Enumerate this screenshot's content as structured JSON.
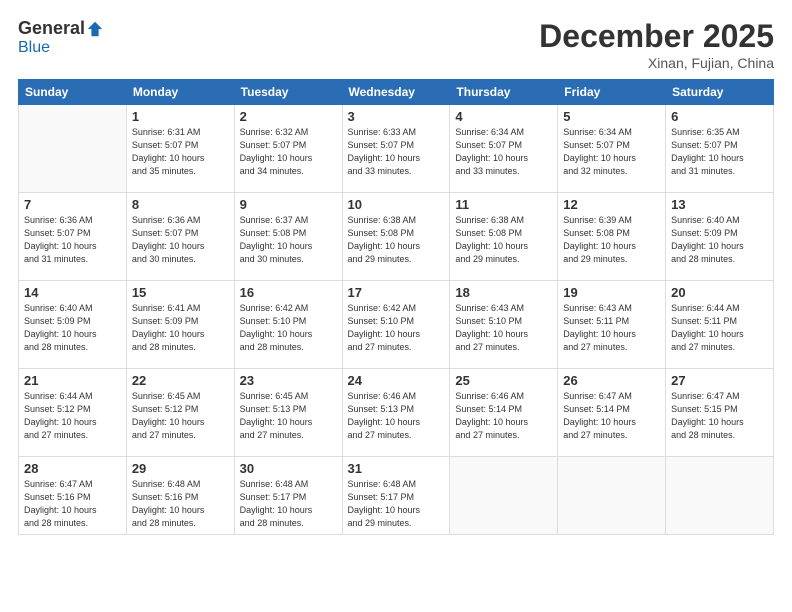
{
  "logo": {
    "general": "General",
    "blue": "Blue"
  },
  "header": {
    "month": "December 2025",
    "location": "Xinan, Fujian, China"
  },
  "weekdays": [
    "Sunday",
    "Monday",
    "Tuesday",
    "Wednesday",
    "Thursday",
    "Friday",
    "Saturday"
  ],
  "weeks": [
    [
      {
        "day": "",
        "info": ""
      },
      {
        "day": "1",
        "info": "Sunrise: 6:31 AM\nSunset: 5:07 PM\nDaylight: 10 hours\nand 35 minutes."
      },
      {
        "day": "2",
        "info": "Sunrise: 6:32 AM\nSunset: 5:07 PM\nDaylight: 10 hours\nand 34 minutes."
      },
      {
        "day": "3",
        "info": "Sunrise: 6:33 AM\nSunset: 5:07 PM\nDaylight: 10 hours\nand 33 minutes."
      },
      {
        "day": "4",
        "info": "Sunrise: 6:34 AM\nSunset: 5:07 PM\nDaylight: 10 hours\nand 33 minutes."
      },
      {
        "day": "5",
        "info": "Sunrise: 6:34 AM\nSunset: 5:07 PM\nDaylight: 10 hours\nand 32 minutes."
      },
      {
        "day": "6",
        "info": "Sunrise: 6:35 AM\nSunset: 5:07 PM\nDaylight: 10 hours\nand 31 minutes."
      }
    ],
    [
      {
        "day": "7",
        "info": "Sunrise: 6:36 AM\nSunset: 5:07 PM\nDaylight: 10 hours\nand 31 minutes."
      },
      {
        "day": "8",
        "info": "Sunrise: 6:36 AM\nSunset: 5:07 PM\nDaylight: 10 hours\nand 30 minutes."
      },
      {
        "day": "9",
        "info": "Sunrise: 6:37 AM\nSunset: 5:08 PM\nDaylight: 10 hours\nand 30 minutes."
      },
      {
        "day": "10",
        "info": "Sunrise: 6:38 AM\nSunset: 5:08 PM\nDaylight: 10 hours\nand 29 minutes."
      },
      {
        "day": "11",
        "info": "Sunrise: 6:38 AM\nSunset: 5:08 PM\nDaylight: 10 hours\nand 29 minutes."
      },
      {
        "day": "12",
        "info": "Sunrise: 6:39 AM\nSunset: 5:08 PM\nDaylight: 10 hours\nand 29 minutes."
      },
      {
        "day": "13",
        "info": "Sunrise: 6:40 AM\nSunset: 5:09 PM\nDaylight: 10 hours\nand 28 minutes."
      }
    ],
    [
      {
        "day": "14",
        "info": "Sunrise: 6:40 AM\nSunset: 5:09 PM\nDaylight: 10 hours\nand 28 minutes."
      },
      {
        "day": "15",
        "info": "Sunrise: 6:41 AM\nSunset: 5:09 PM\nDaylight: 10 hours\nand 28 minutes."
      },
      {
        "day": "16",
        "info": "Sunrise: 6:42 AM\nSunset: 5:10 PM\nDaylight: 10 hours\nand 28 minutes."
      },
      {
        "day": "17",
        "info": "Sunrise: 6:42 AM\nSunset: 5:10 PM\nDaylight: 10 hours\nand 27 minutes."
      },
      {
        "day": "18",
        "info": "Sunrise: 6:43 AM\nSunset: 5:10 PM\nDaylight: 10 hours\nand 27 minutes."
      },
      {
        "day": "19",
        "info": "Sunrise: 6:43 AM\nSunset: 5:11 PM\nDaylight: 10 hours\nand 27 minutes."
      },
      {
        "day": "20",
        "info": "Sunrise: 6:44 AM\nSunset: 5:11 PM\nDaylight: 10 hours\nand 27 minutes."
      }
    ],
    [
      {
        "day": "21",
        "info": "Sunrise: 6:44 AM\nSunset: 5:12 PM\nDaylight: 10 hours\nand 27 minutes."
      },
      {
        "day": "22",
        "info": "Sunrise: 6:45 AM\nSunset: 5:12 PM\nDaylight: 10 hours\nand 27 minutes."
      },
      {
        "day": "23",
        "info": "Sunrise: 6:45 AM\nSunset: 5:13 PM\nDaylight: 10 hours\nand 27 minutes."
      },
      {
        "day": "24",
        "info": "Sunrise: 6:46 AM\nSunset: 5:13 PM\nDaylight: 10 hours\nand 27 minutes."
      },
      {
        "day": "25",
        "info": "Sunrise: 6:46 AM\nSunset: 5:14 PM\nDaylight: 10 hours\nand 27 minutes."
      },
      {
        "day": "26",
        "info": "Sunrise: 6:47 AM\nSunset: 5:14 PM\nDaylight: 10 hours\nand 27 minutes."
      },
      {
        "day": "27",
        "info": "Sunrise: 6:47 AM\nSunset: 5:15 PM\nDaylight: 10 hours\nand 28 minutes."
      }
    ],
    [
      {
        "day": "28",
        "info": "Sunrise: 6:47 AM\nSunset: 5:16 PM\nDaylight: 10 hours\nand 28 minutes."
      },
      {
        "day": "29",
        "info": "Sunrise: 6:48 AM\nSunset: 5:16 PM\nDaylight: 10 hours\nand 28 minutes."
      },
      {
        "day": "30",
        "info": "Sunrise: 6:48 AM\nSunset: 5:17 PM\nDaylight: 10 hours\nand 28 minutes."
      },
      {
        "day": "31",
        "info": "Sunrise: 6:48 AM\nSunset: 5:17 PM\nDaylight: 10 hours\nand 29 minutes."
      },
      {
        "day": "",
        "info": ""
      },
      {
        "day": "",
        "info": ""
      },
      {
        "day": "",
        "info": ""
      }
    ]
  ]
}
